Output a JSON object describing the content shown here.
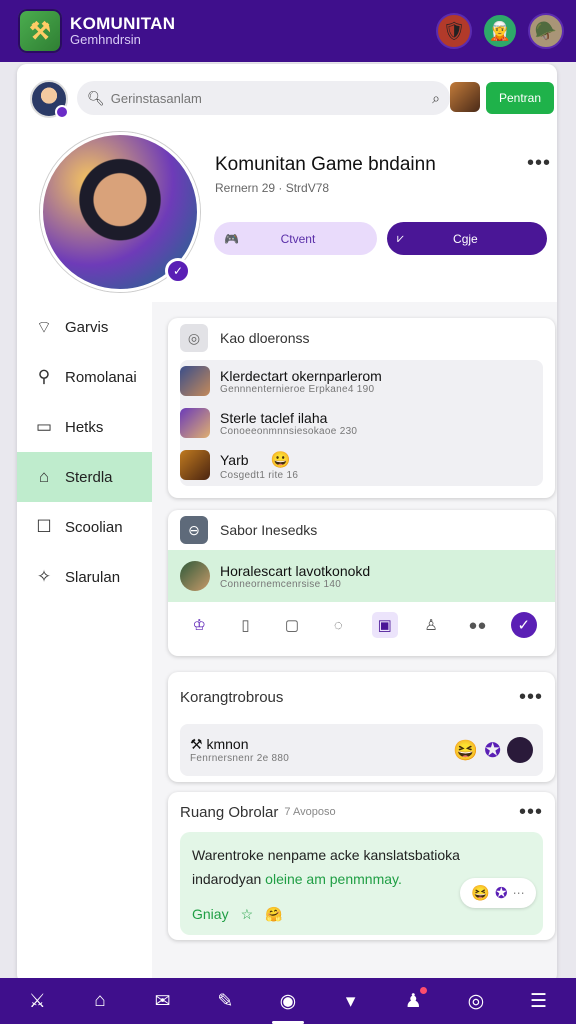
{
  "app": {
    "title": "KOMUNITAN",
    "subtitle": "Gemhndrsin",
    "logo_icon": "hammer-icon",
    "header_avatars": [
      "warrior-avatar",
      "character-avatar",
      "soldier-avatar"
    ]
  },
  "search": {
    "placeholder": "Gerinstasanlam",
    "value": "Gerinstasanlam"
  },
  "header": {
    "primary_button": "Pentran",
    "title": "Komunitan Game bndainn",
    "subtitle": "Rernern 29 · StrdV78",
    "left_pill": "Ctvent",
    "right_pill": "Cgje"
  },
  "sidebar": {
    "items": [
      {
        "label": "Garvis",
        "icon": "tag-icon",
        "active": false
      },
      {
        "label": "Romolanai",
        "icon": "location-pin-icon",
        "active": false
      },
      {
        "label": "Hetks",
        "icon": "document-icon",
        "active": false
      },
      {
        "label": "Sterdla",
        "icon": "home-icon",
        "active": true
      },
      {
        "label": "Scoolian",
        "icon": "square-icon",
        "active": false
      },
      {
        "label": "Slarulan",
        "icon": "sparkle-icon",
        "active": false
      }
    ]
  },
  "cards": {
    "members": {
      "title": "Kao dloeronss",
      "rows": [
        {
          "name": "Klerdectart okernparlerom",
          "meta": "Gennnenternieroe  Erpkane4 190"
        },
        {
          "name": "Sterle taclef ilaha",
          "meta": "Conoeeonmnnsiesokaoe 230"
        },
        {
          "name": "Yarb",
          "meta": "Cosgedt1 rite 16",
          "emoji": "😀"
        }
      ]
    },
    "recent": {
      "title": "Sabor Inesedks",
      "row": {
        "name": "Horalescart lavotkonokd",
        "meta": "Conneornemcenrsise 140"
      }
    },
    "forum": {
      "title": "Korangtrobrous",
      "row": {
        "name": "kmnon",
        "meta": "Fenrnersnenr 2e 880"
      }
    },
    "chat": {
      "title": "Ruang Obrolar",
      "title_suffix": "7 Avoposo",
      "message": "Warentroke nenpame acke kanslatsbatioka indarodyan",
      "message_link": "oleine am penmnmay.",
      "foot_label": "Gniay"
    }
  },
  "colors": {
    "brand_purple": "#3f0f8c",
    "accent_green": "#1fb24a",
    "sidebar_active": "#bfeccd"
  }
}
